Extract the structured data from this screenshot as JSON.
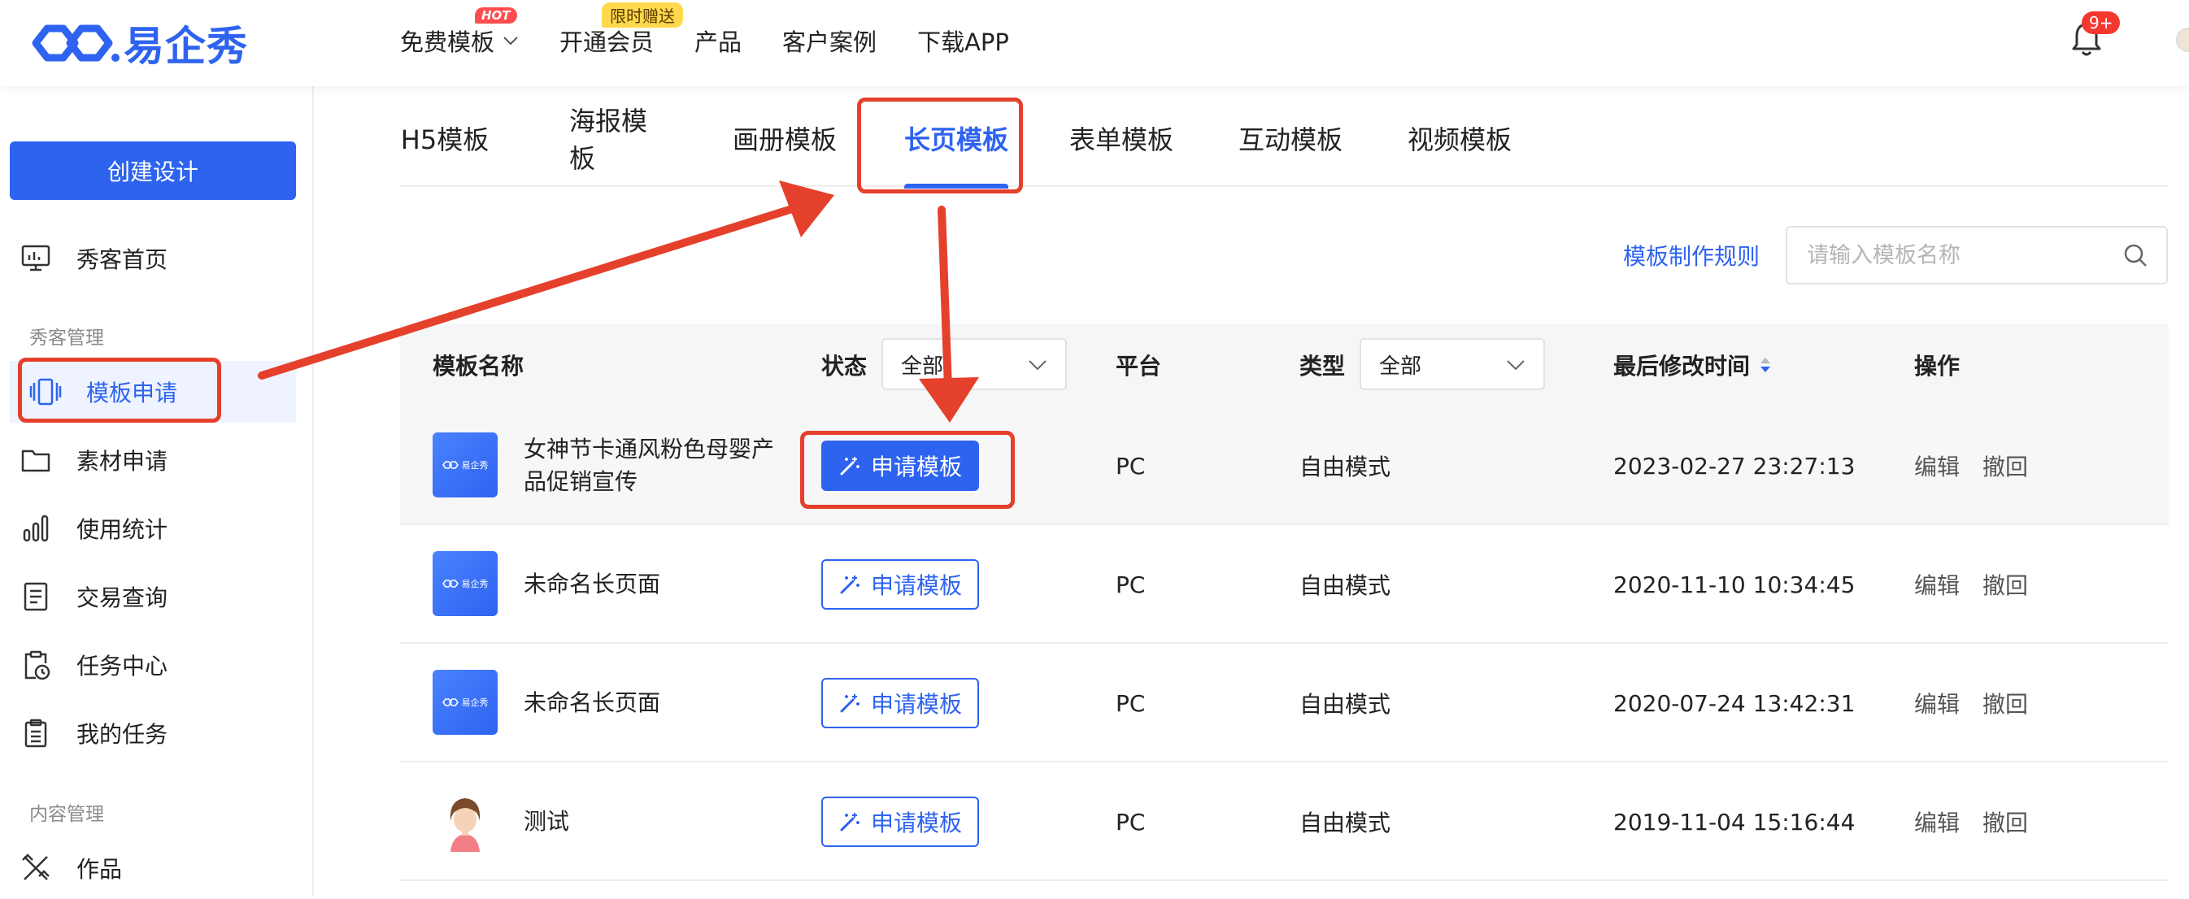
{
  "header": {
    "logo_text": "易企秀",
    "nav": [
      {
        "label": "免费模板",
        "badge": "HOT"
      },
      {
        "label": "开通会员",
        "badge": "限时赠送"
      },
      {
        "label": "产品"
      },
      {
        "label": "客户案例"
      },
      {
        "label": "下载APP"
      }
    ],
    "notification_badge": "9+"
  },
  "sidebar": {
    "create_button": "创建设计",
    "home": "秀客首页",
    "section_1": "秀客管理",
    "items": [
      "模板申请",
      "素材申请",
      "使用统计",
      "交易查询",
      "任务中心",
      "我的任务"
    ],
    "section_2": "内容管理",
    "works": "作品"
  },
  "tabs": [
    "H5模板",
    "海报模板",
    "画册模板",
    "长页模板",
    "表单模板",
    "互动模板",
    "视频模板"
  ],
  "active_tab": "长页模板",
  "toolbar": {
    "rules_link": "模板制作规则",
    "search_placeholder": "请输入模板名称"
  },
  "table": {
    "headers": {
      "name": "模板名称",
      "status": "状态",
      "status_filter": "全部",
      "platform": "平台",
      "type": "类型",
      "type_filter": "全部",
      "modified": "最后修改时间",
      "actions": "操作"
    },
    "rows": [
      {
        "name": "女神节卡通风粉色母婴产品促销宣传",
        "action": "申请模板",
        "platform": "PC",
        "type": "自由模式",
        "modified": "2023-02-27 23:27:13",
        "edit": "编辑",
        "revoke": "撤回"
      },
      {
        "name": "未命名长页面",
        "action": "申请模板",
        "platform": "PC",
        "type": "自由模式",
        "modified": "2020-11-10 10:34:45",
        "edit": "编辑",
        "revoke": "撤回"
      },
      {
        "name": "未命名长页面",
        "action": "申请模板",
        "platform": "PC",
        "type": "自由模式",
        "modified": "2020-07-24 13:42:31",
        "edit": "编辑",
        "revoke": "撤回"
      },
      {
        "name": "测试",
        "action": "申请模板",
        "platform": "PC",
        "type": "自由模式",
        "modified": "2019-11-04 15:16:44",
        "edit": "编辑",
        "revoke": "撤回"
      }
    ],
    "thumb_label": "易企秀"
  },
  "colors": {
    "accent": "#2e63f0",
    "annotation": "#e5402b",
    "hot": "#ff4d4f",
    "limit": "#ffd84d"
  }
}
